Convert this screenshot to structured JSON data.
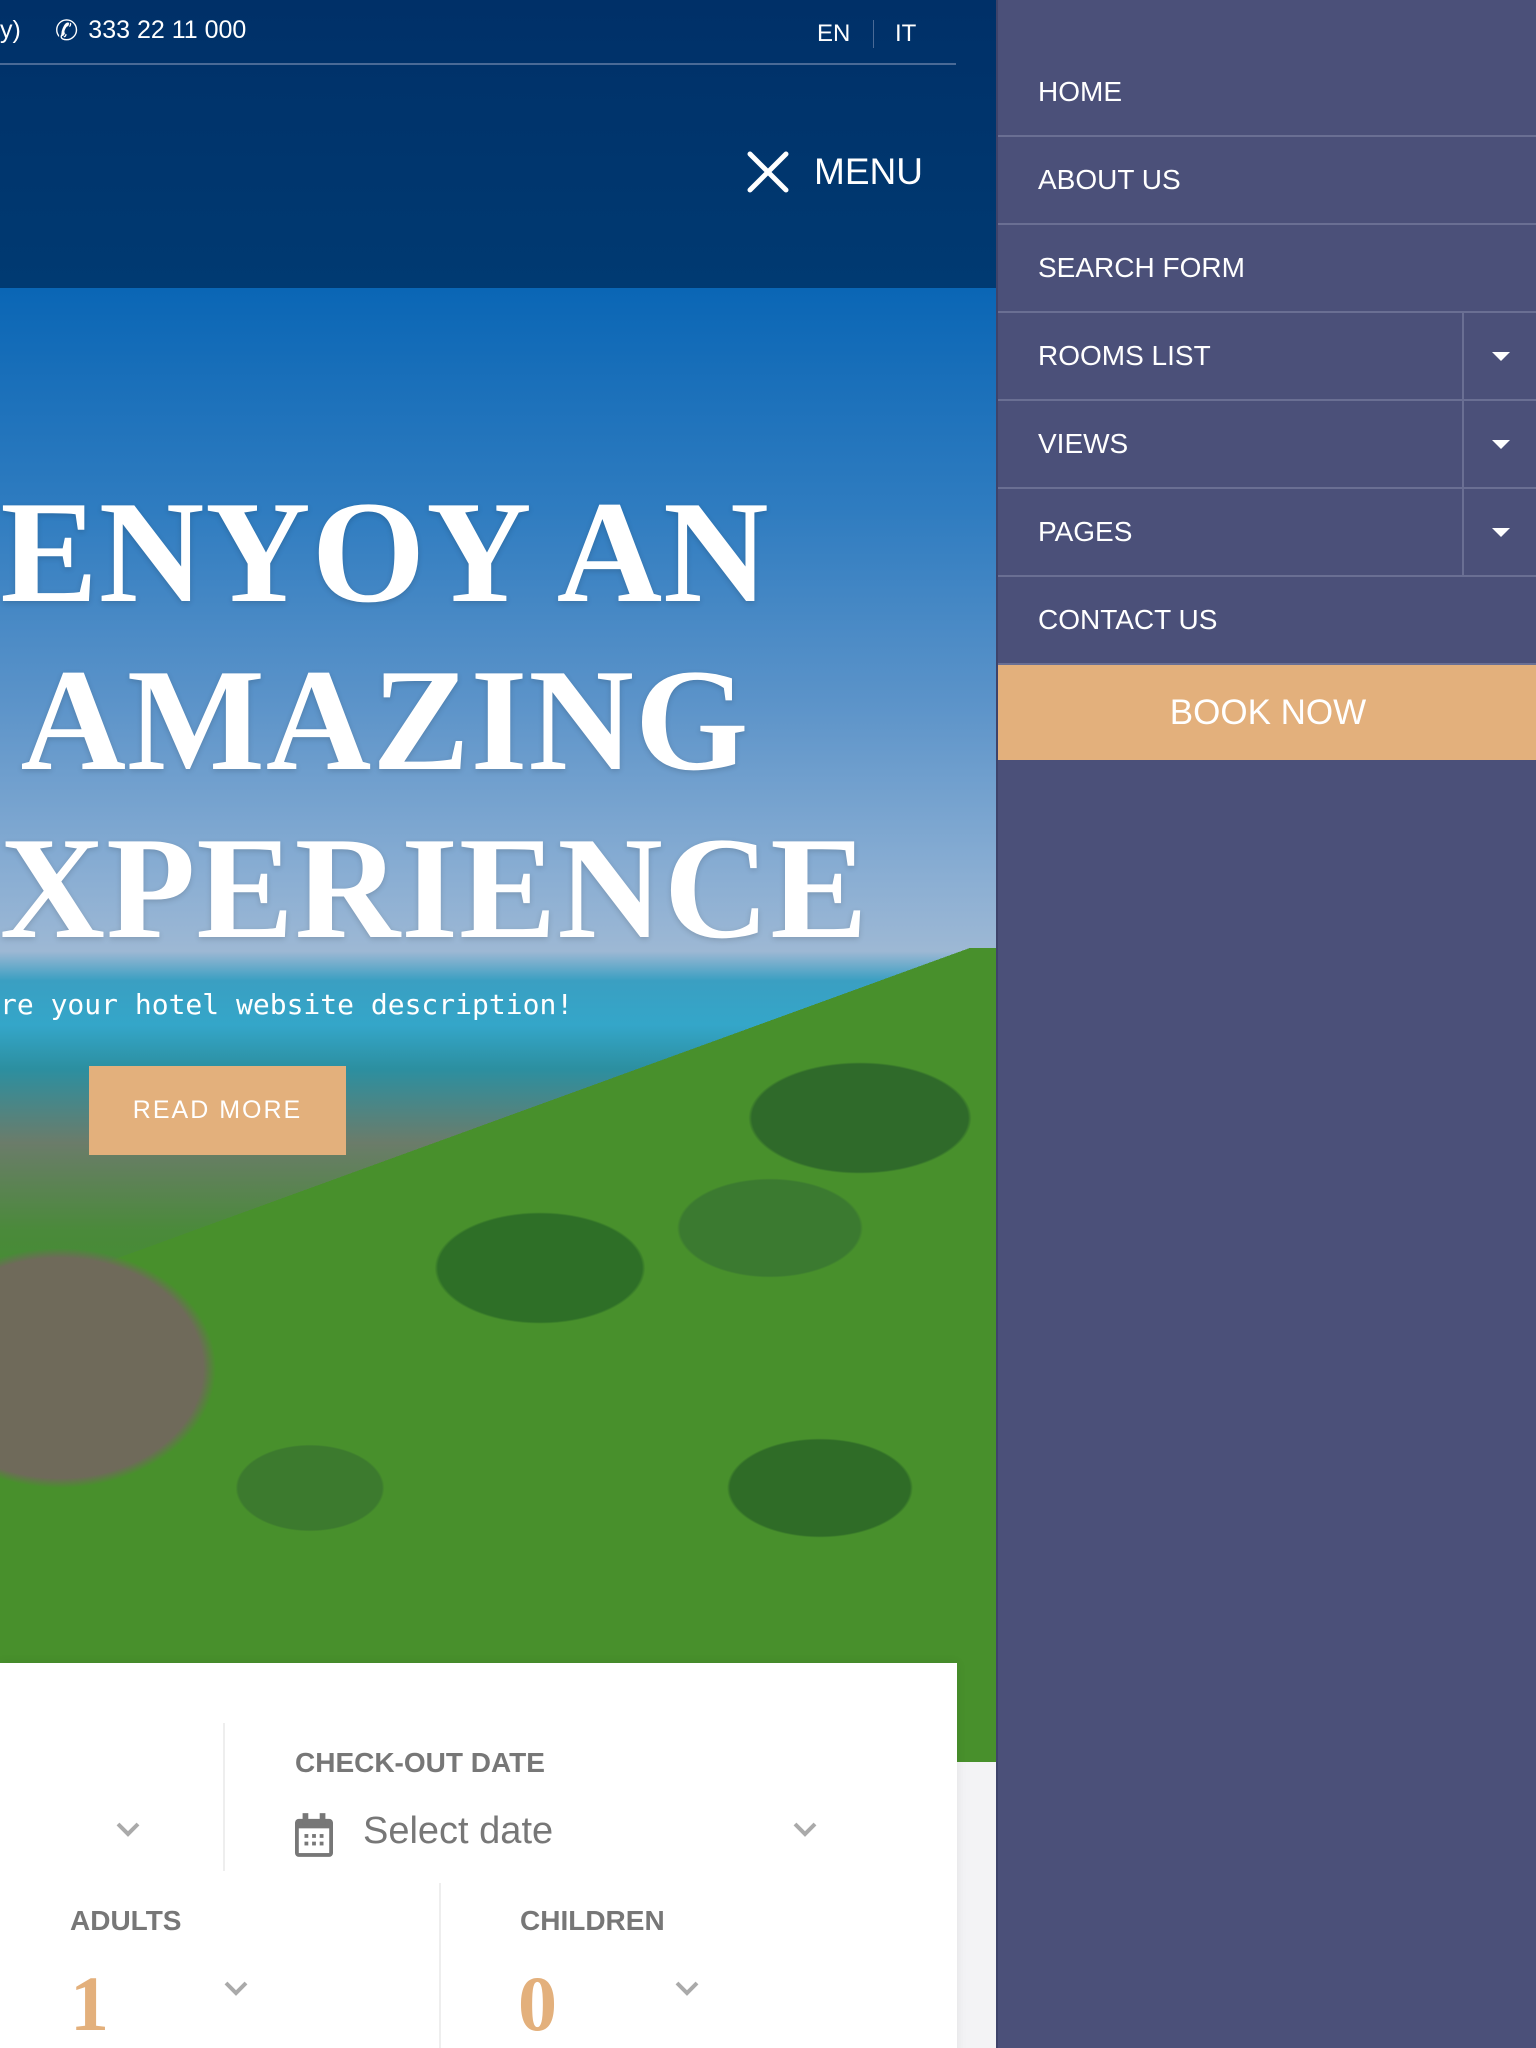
{
  "topbar": {
    "phone_prefix": "y)",
    "phone": "333 22 11 000",
    "languages": [
      "EN",
      "IT"
    ]
  },
  "header": {
    "menu_label": "MENU"
  },
  "hero": {
    "title_lines": [
      "ENYOY AN",
      "AMAZING",
      "EXPERIENCE"
    ],
    "subtitle": "re your hotel website description!",
    "button": "READ MORE"
  },
  "form": {
    "checkout_label": "CHECK-OUT DATE",
    "checkout_placeholder": "Select date",
    "adults_label": "ADULTS",
    "adults_value": "1",
    "children_label": "CHILDREN",
    "children_value": "0"
  },
  "nav": {
    "items": [
      {
        "label": "HOME"
      },
      {
        "label": "ABOUT US"
      },
      {
        "label": "SEARCH FORM"
      },
      {
        "label": "ROOMS LIST",
        "dropdown": true
      },
      {
        "label": "VIEWS",
        "dropdown": true
      },
      {
        "label": "PAGES",
        "dropdown": true
      },
      {
        "label": "CONTACT US"
      }
    ],
    "book_now": "BOOK NOW"
  },
  "colors": {
    "header": "#003068",
    "nav_bg": "#4b5079",
    "accent": "#e3b07c"
  }
}
